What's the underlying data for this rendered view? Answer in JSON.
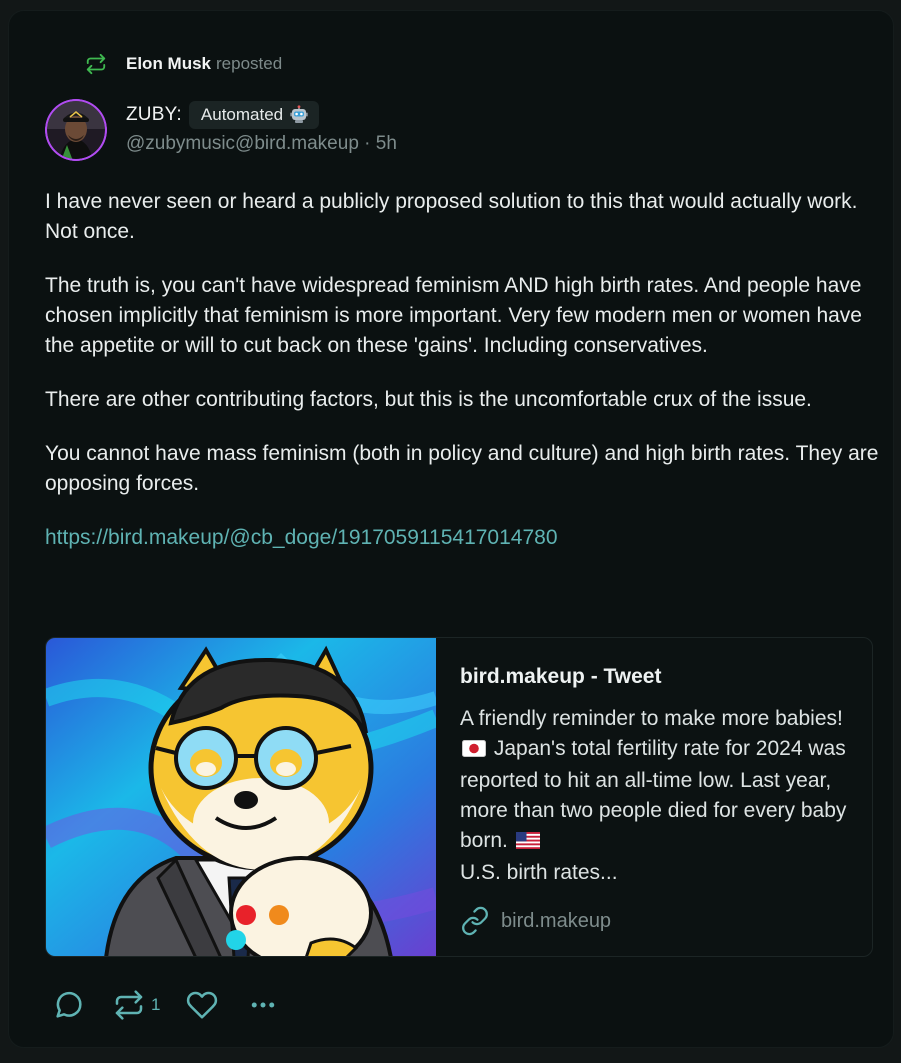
{
  "repost": {
    "name": "Elon Musk",
    "verb": "reposted"
  },
  "author": {
    "display_name": "ZUBY:",
    "badge": "Automated",
    "handle": "@zubymusic@bird.makeup",
    "separator": "·",
    "time": "5h"
  },
  "post": {
    "paragraphs": [
      "I have never seen or heard a publicly proposed solution to this that would actually work. Not once.",
      "The truth is, you can't have widespread feminism AND high birth rates. And people have chosen implicitly that feminism is more important. Very few modern men or women have the appetite or will to cut back on these 'gains'. Including conservatives.",
      "There are other contributing factors, but this is the uncomfortable crux of the issue.",
      "You cannot have mass feminism (both in policy and culture) and high birth rates. They are opposing forces."
    ],
    "link": "https://bird.makeup/@cb_doge/1917059115417014780"
  },
  "link_card": {
    "title": "bird.makeup - Tweet",
    "desc_part1": "A friendly reminder to make more babies!",
    "desc_part2": "Japan's total fertility rate for 2024 was reported to hit an all-time low. Last year, more than two people died for every baby born.",
    "desc_part3": "U.S. birth rates...",
    "domain": "bird.makeup",
    "flag_1": "japan-flag-icon",
    "flag_2": "us-flag-icon"
  },
  "actions": {
    "reply_icon": "reply-icon",
    "boost_icon": "boost-icon",
    "boost_count": "1",
    "favourite_icon": "heart-icon",
    "more_icon": "more-icon"
  },
  "colors": {
    "background": "#0b1111",
    "accent": "#5fb3b3",
    "repost_icon": "#3fb950",
    "avatar_ring": "#b04cf0"
  }
}
